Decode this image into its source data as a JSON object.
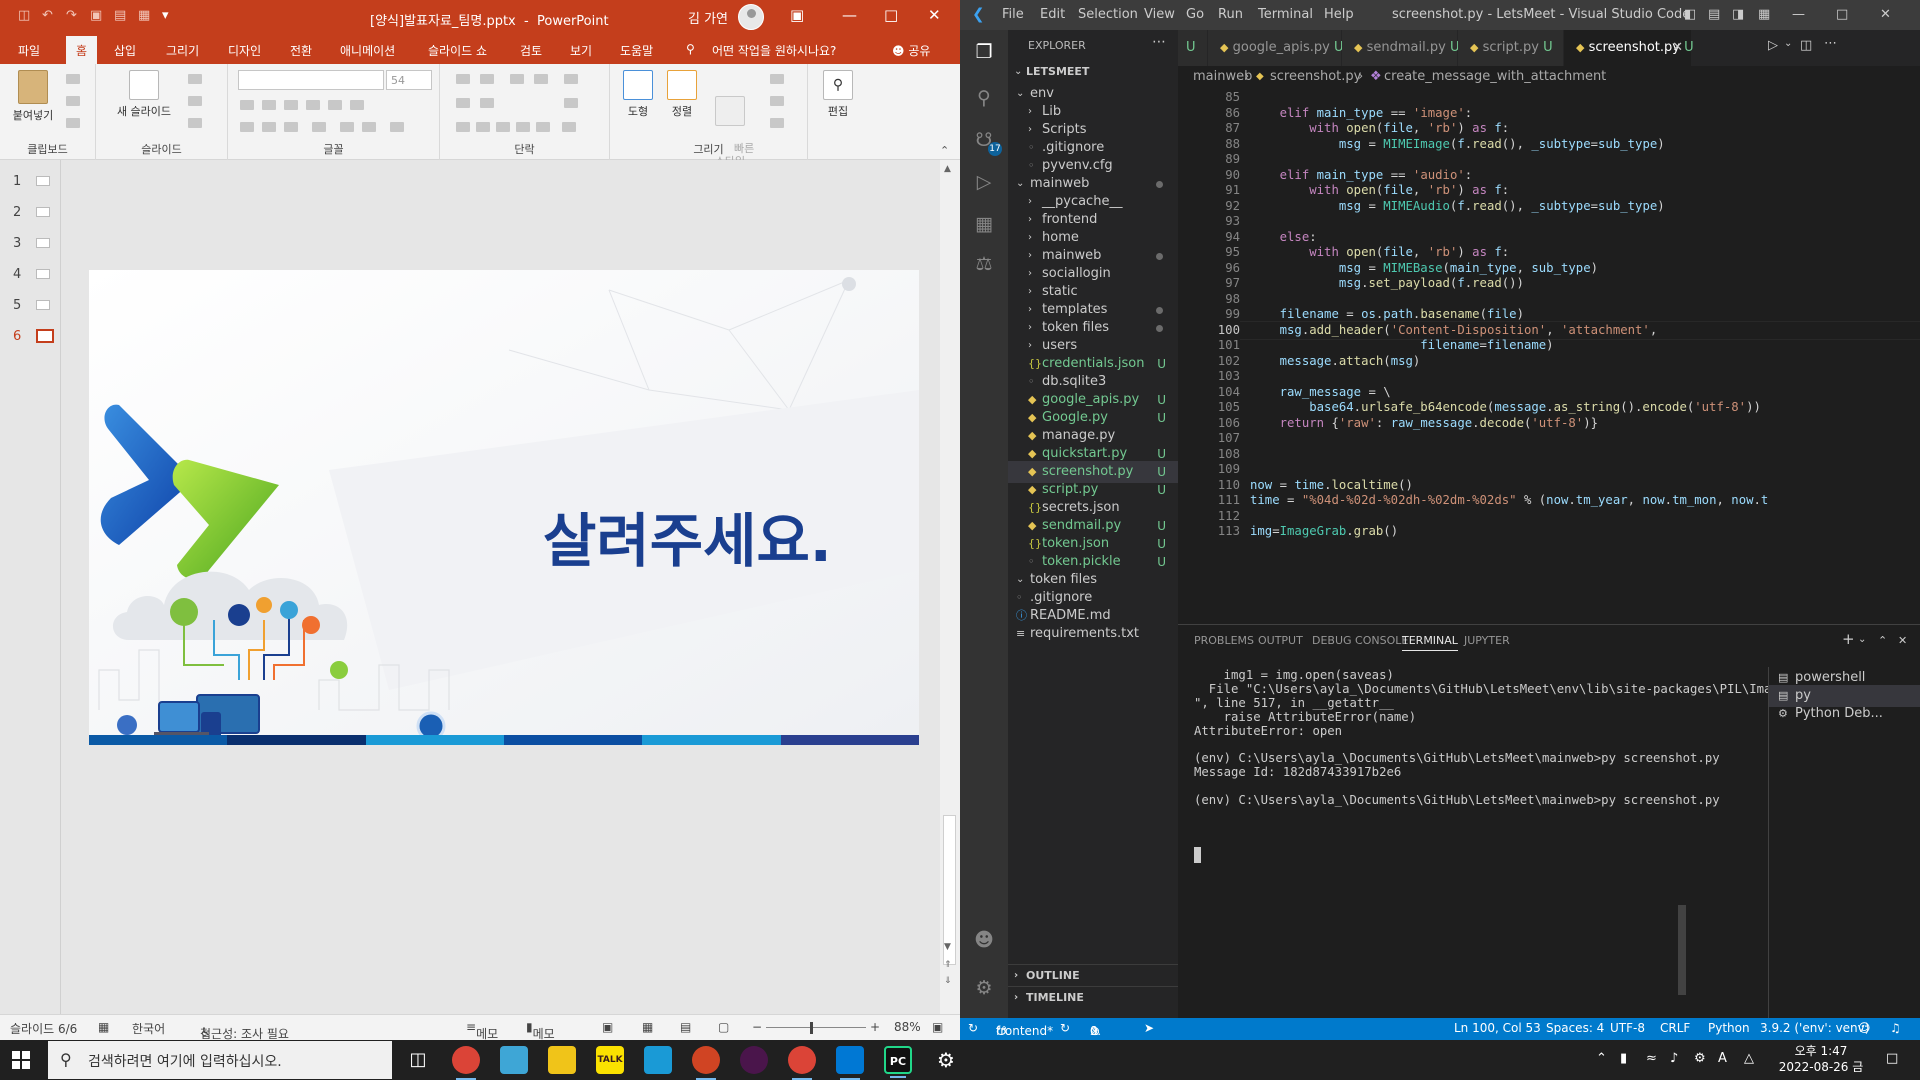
{
  "powerpoint": {
    "document_title": "[양식]발표자료_팀명.pptx",
    "app_name": "PowerPoint",
    "user_name": "김 가연",
    "tabs": [
      "파일",
      "홈",
      "삽입",
      "그리기",
      "디자인",
      "전환",
      "애니메이션",
      "슬라이드 쇼",
      "검토",
      "보기",
      "도움말"
    ],
    "active_tab": "홈",
    "tell_me": "어떤 작업을 원하시나요?",
    "share": "공유",
    "ribbon": {
      "paste": "붙여넣기",
      "clipboard_group": "클립보드",
      "new_slide": "새 슬라이드",
      "slides_group": "슬라이드",
      "font_size": "54",
      "font_group": "글꼴",
      "paragraph_group": "단락",
      "shapes": "도형",
      "arrange": "정렬",
      "quick_styles": "빠른\n스타일",
      "drawing_group": "그리기",
      "editing": "편집"
    },
    "thumbnails": [
      "1",
      "2",
      "3",
      "4",
      "5",
      "6"
    ],
    "selected_slide": "6",
    "slide_title": "살려주세요.",
    "status": {
      "slide_counter": "슬라이드 6/6",
      "language": "한국어",
      "accessibility": "접근성: 조사 필요",
      "notes": "메모",
      "comments": "메모",
      "zoom": "88%"
    }
  },
  "vscode": {
    "window_title": "screenshot.py - LetsMeet - Visual Studio Code",
    "menu": [
      "File",
      "Edit",
      "Selection",
      "View",
      "Go",
      "Run",
      "Terminal",
      "Help"
    ],
    "source_control_badge": "17",
    "explorer": {
      "title": "EXPLORER",
      "root": "LETSMEET",
      "items": [
        {
          "name": "env",
          "depth": 1,
          "type": "folder-open",
          "status": ""
        },
        {
          "name": "Lib",
          "depth": 2,
          "type": "folder",
          "status": ""
        },
        {
          "name": "Scripts",
          "depth": 2,
          "type": "folder",
          "status": ""
        },
        {
          "name": ".gitignore",
          "depth": 2,
          "type": "file",
          "status": ""
        },
        {
          "name": "pyvenv.cfg",
          "depth": 2,
          "type": "file",
          "status": ""
        },
        {
          "name": "mainweb",
          "depth": 1,
          "type": "folder-open",
          "status": "dot"
        },
        {
          "name": "__pycache__",
          "depth": 2,
          "type": "folder",
          "status": ""
        },
        {
          "name": "frontend",
          "depth": 2,
          "type": "folder",
          "status": ""
        },
        {
          "name": "home",
          "depth": 2,
          "type": "folder",
          "status": ""
        },
        {
          "name": "mainweb",
          "depth": 2,
          "type": "folder",
          "status": "dot"
        },
        {
          "name": "sociallogin",
          "depth": 2,
          "type": "folder",
          "status": ""
        },
        {
          "name": "static",
          "depth": 2,
          "type": "folder",
          "status": ""
        },
        {
          "name": "templates",
          "depth": 2,
          "type": "folder",
          "status": "dot"
        },
        {
          "name": "token files",
          "depth": 2,
          "type": "folder",
          "status": "dot"
        },
        {
          "name": "users",
          "depth": 2,
          "type": "folder",
          "status": ""
        },
        {
          "name": "credentials.json",
          "depth": 2,
          "type": "json",
          "status": "U"
        },
        {
          "name": "db.sqlite3",
          "depth": 2,
          "type": "file",
          "status": ""
        },
        {
          "name": "google_apis.py",
          "depth": 2,
          "type": "py",
          "status": "U"
        },
        {
          "name": "Google.py",
          "depth": 2,
          "type": "py",
          "status": "U"
        },
        {
          "name": "manage.py",
          "depth": 2,
          "type": "py",
          "status": ""
        },
        {
          "name": "quickstart.py",
          "depth": 2,
          "type": "py",
          "status": "U"
        },
        {
          "name": "screenshot.py",
          "depth": 2,
          "type": "py",
          "status": "U",
          "selected": true
        },
        {
          "name": "script.py",
          "depth": 2,
          "type": "py",
          "status": "U"
        },
        {
          "name": "secrets.json",
          "depth": 2,
          "type": "json",
          "status": ""
        },
        {
          "name": "sendmail.py",
          "depth": 2,
          "type": "py",
          "status": "U"
        },
        {
          "name": "token.json",
          "depth": 2,
          "type": "json",
          "status": "U"
        },
        {
          "name": "token.pickle",
          "depth": 2,
          "type": "file",
          "status": "U"
        },
        {
          "name": "token files",
          "depth": 1,
          "type": "folder-open",
          "status": ""
        },
        {
          "name": ".gitignore",
          "depth": 1,
          "type": "file",
          "status": ""
        },
        {
          "name": "README.md",
          "depth": 1,
          "type": "info",
          "status": ""
        },
        {
          "name": "requirements.txt",
          "depth": 1,
          "type": "txt",
          "status": ""
        }
      ],
      "outline": "OUTLINE",
      "timeline": "TIMELINE"
    },
    "tabs": [
      {
        "name": "U",
        "status": ""
      },
      {
        "name": "google_apis.py",
        "status": "U"
      },
      {
        "name": "sendmail.py",
        "status": "U"
      },
      {
        "name": "script.py",
        "status": "U"
      },
      {
        "name": "screenshot.py",
        "status": "U",
        "active": true
      }
    ],
    "breadcrumb": [
      "mainweb",
      "screenshot.py",
      "create_message_with_attachment"
    ],
    "code": [
      {
        "n": "85",
        "html": ""
      },
      {
        "n": "86",
        "html": "    <span class=\"kw\">elif</span> <span class=\"vr\">main_type</span> == <span class=\"str\">'image'</span>:"
      },
      {
        "n": "87",
        "html": "        <span class=\"kw\">with</span> <span class=\"fn\">open</span>(<span class=\"vr\">file</span>, <span class=\"str\">'rb'</span>) <span class=\"kw\">as</span> <span class=\"vr\">f</span>:"
      },
      {
        "n": "88",
        "html": "            <span class=\"vr\">msg</span> = <span class=\"cls\">MIMEImage</span>(<span class=\"vr\">f</span>.<span class=\"fn\">read</span>(), <span class=\"vr\">_subtype</span>=<span class=\"vr\">sub_type</span>)"
      },
      {
        "n": "89",
        "html": ""
      },
      {
        "n": "90",
        "html": "    <span class=\"kw\">elif</span> <span class=\"vr\">main_type</span> == <span class=\"str\">'audio'</span>:"
      },
      {
        "n": "91",
        "html": "        <span class=\"kw\">with</span> <span class=\"fn\">open</span>(<span class=\"vr\">file</span>, <span class=\"str\">'rb'</span>) <span class=\"kw\">as</span> <span class=\"vr\">f</span>:"
      },
      {
        "n": "92",
        "html": "            <span class=\"vr\">msg</span> = <span class=\"cls\">MIMEAudio</span>(<span class=\"vr\">f</span>.<span class=\"fn\">read</span>(), <span class=\"vr\">_subtype</span>=<span class=\"vr\">sub_type</span>)"
      },
      {
        "n": "93",
        "html": ""
      },
      {
        "n": "94",
        "html": "    <span class=\"kw\">else</span>:"
      },
      {
        "n": "95",
        "html": "        <span class=\"kw\">with</span> <span class=\"fn\">open</span>(<span class=\"vr\">file</span>, <span class=\"str\">'rb'</span>) <span class=\"kw\">as</span> <span class=\"vr\">f</span>:"
      },
      {
        "n": "96",
        "html": "            <span class=\"vr\">msg</span> = <span class=\"cls\">MIMEBase</span>(<span class=\"vr\">main_type</span>, <span class=\"vr\">sub_type</span>)"
      },
      {
        "n": "97",
        "html": "            <span class=\"vr\">msg</span>.<span class=\"fn\">set_payload</span>(<span class=\"vr\">f</span>.<span class=\"fn\">read</span>())"
      },
      {
        "n": "98",
        "html": ""
      },
      {
        "n": "99",
        "html": "    <span class=\"vr\">filename</span> = <span class=\"vr\">os</span>.<span class=\"vr\">path</span>.<span class=\"fn\">basename</span>(<span class=\"vr\">file</span>)"
      },
      {
        "n": "100",
        "html": "    <span class=\"vr\">msg</span>.<span class=\"fn\">add_header</span>(<span class=\"str\">'Content-Disposition'</span>, <span class=\"str\">'attachment'</span>,",
        "current": true
      },
      {
        "n": "101",
        "html": "                       <span class=\"vr\">filename</span>=<span class=\"vr\">filename</span>)"
      },
      {
        "n": "102",
        "html": "    <span class=\"vr\">message</span>.<span class=\"fn\">attach</span>(<span class=\"vr\">msg</span>)"
      },
      {
        "n": "103",
        "html": ""
      },
      {
        "n": "104",
        "html": "    <span class=\"vr\">raw_message</span> = \\"
      },
      {
        "n": "105",
        "html": "        <span class=\"vr\">base64</span>.<span class=\"fn\">urlsafe_b64encode</span>(<span class=\"vr\">message</span>.<span class=\"fn\">as_string</span>().<span class=\"fn\">encode</span>(<span class=\"str\">'utf-8'</span>))"
      },
      {
        "n": "106",
        "html": "    <span class=\"kw\">return</span> {<span class=\"str\">'raw'</span>: <span class=\"vr\">raw_message</span>.<span class=\"fn\">decode</span>(<span class=\"str\">'utf-8'</span>)}"
      },
      {
        "n": "107",
        "html": ""
      },
      {
        "n": "108",
        "html": ""
      },
      {
        "n": "109",
        "html": ""
      },
      {
        "n": "110",
        "html": "<span class=\"vr\">now</span> = <span class=\"vr\">time</span>.<span class=\"fn\">localtime</span>()"
      },
      {
        "n": "111",
        "html": "<span class=\"vr\">time</span> = <span class=\"str\">\"%04d-%02d-%02dh-%02dm-%02ds\"</span> % (<span class=\"vr\">now</span>.<span class=\"vr\">tm_year</span>, <span class=\"vr\">now</span>.<span class=\"vr\">tm_mon</span>, <span class=\"vr\">now</span>.<span class=\"vr\">t</span>"
      },
      {
        "n": "112",
        "html": ""
      },
      {
        "n": "113",
        "html": "<span class=\"vr\">img</span>=<span class=\"cls\">ImageGrab</span>.<span class=\"fn\">grab</span>()"
      }
    ],
    "panel_tabs": [
      "PROBLEMS",
      "OUTPUT",
      "DEBUG CONSOLE",
      "TERMINAL",
      "JUPYTER"
    ],
    "active_panel_tab": "TERMINAL",
    "terminal_lines": [
      "    img1 = img.open(saveas)",
      "  File \"C:\\Users\\ayla_\\Documents\\GitHub\\LetsMeet\\env\\lib\\site-packages\\PIL\\Image.py",
      "\", line 517, in __getattr__",
      "    raise AttributeError(name)",
      "AttributeError: open",
      "",
      "(env) C:\\Users\\ayla_\\Documents\\GitHub\\LetsMeet\\mainweb>py screenshot.py",
      "Message Id: 182d87433917b2e6",
      "",
      "(env) C:\\Users\\ayla_\\Documents\\GitHub\\LetsMeet\\mainweb>py screenshot.py"
    ],
    "terminals": [
      "powershell",
      "py",
      "Python Deb..."
    ],
    "statusbar": {
      "branch": "frontend*",
      "errors": "0",
      "warnings": "0",
      "position": "Ln 100, Col 53",
      "spaces": "Spaces: 4",
      "encoding": "UTF-8",
      "eol": "CRLF",
      "language": "Python",
      "interpreter": "3.9.2 ('env': venv)"
    }
  },
  "taskbar": {
    "search_placeholder": "검색하려면 여기에 입력하십시오.",
    "time": "오후 1:47",
    "date": "2022-08-26 금",
    "ime": "A",
    "kakao_label": "TALK",
    "pycharm_label": "PC"
  },
  "colors": {
    "ppt_accent": "#c43e1c",
    "vscode_status": "#007acc",
    "slide_title": "#1a3f8f"
  }
}
